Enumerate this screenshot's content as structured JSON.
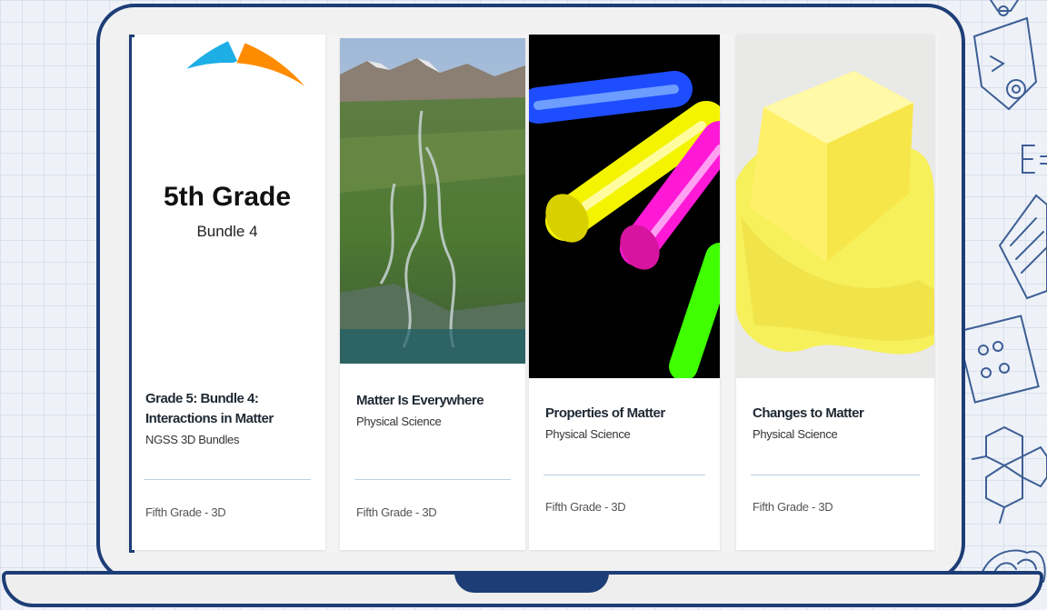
{
  "palette": {
    "frame": "#1d3d76",
    "ring_blue": "#1eaee6",
    "ring_orange": "#ff8c00",
    "ring_green": "#7ccf2c"
  },
  "cards": [
    {
      "image_icon": "grade-bundle-ring-icon",
      "image_title": "5th Grade",
      "image_subtitle": "Bundle 4",
      "title": "Grade 5: Bundle 4: Interactions in Matter",
      "subtitle": "NGSS 3D Bundles",
      "footer": "Fifth Grade - 3D"
    },
    {
      "image_icon": "river-delta-photo",
      "title": "Matter Is Everywhere",
      "subtitle": "Physical Science",
      "footer": "Fifth Grade - 3D"
    },
    {
      "image_icon": "glow-sticks-photo",
      "title": "Properties of Matter",
      "subtitle": "Physical Science",
      "footer": "Fifth Grade - 3D"
    },
    {
      "image_icon": "melting-butter-photo",
      "title": "Changes to Matter",
      "subtitle": "Physical Science",
      "footer": "Fifth Grade - 3D"
    }
  ]
}
